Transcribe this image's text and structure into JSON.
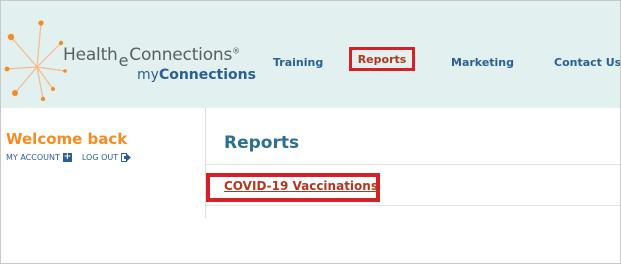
{
  "header": {
    "logo": {
      "brand_part1": "Health",
      "brand_e": "e",
      "brand_part2": "Connections",
      "registered": "®",
      "sub_prefix": "my",
      "sub_strong": "Connections",
      "icon": "orange-starburst-icon"
    },
    "nav": [
      {
        "label": "Training"
      },
      {
        "label": "Reports",
        "highlighted": true
      },
      {
        "label": "Marketing"
      },
      {
        "label": "Contact Us"
      }
    ]
  },
  "sidebar": {
    "welcome": "Welcome back",
    "my_account": "MY ACCOUNT",
    "log_out": "LOG OUT",
    "icons": {
      "my_account": "plus-square-icon",
      "log_out": "logout-arrow-icon"
    }
  },
  "main": {
    "title": "Reports",
    "links": [
      {
        "label": "COVID-19 Vaccinations",
        "highlighted": true
      }
    ]
  },
  "colors": {
    "header_bg": "#e2f0f0",
    "nav_text": "#2a5f93",
    "highlight_border": "#d42026",
    "welcome_orange": "#f58c21",
    "link_red": "#b5361f",
    "title_teal": "#2e6e8e"
  }
}
